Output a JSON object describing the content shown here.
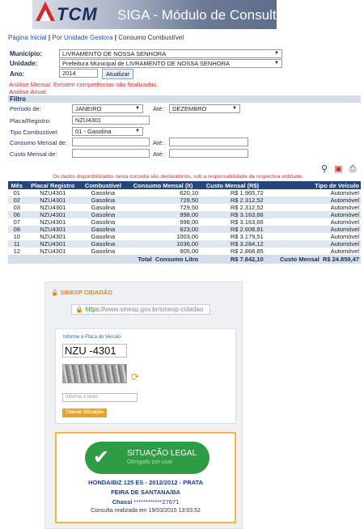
{
  "header": {
    "logo": "TCM",
    "title": "SIGA - Módulo de Consulta"
  },
  "breadcrumb": {
    "home": "Página Inicial",
    "sep1": "|",
    "gestora": "Por Unidade Gestora",
    "sep2": "|",
    "current": "Consumo Combustível"
  },
  "form": {
    "municipio_label": "Município:",
    "municipio_value": "LIVRAMENTO DE NOSSA SENHORA",
    "unidade_label": "Unidade:",
    "unidade_value": "Prefeitura Municipal de LIVRAMENTO DE NOSSA SENHORA",
    "ano_label": "Ano:",
    "ano_value": "2014",
    "atualizar": "Atualizar",
    "warn1": "Análise Mensal: Existem competências não finalizadas.",
    "warn2": "Análise Anual:"
  },
  "filtro": {
    "title": "Filtro",
    "periodo_label": "Período de:",
    "periodo_de": "JANEIRO",
    "ate_label": "Até:",
    "periodo_ate": "DEZEMBRO",
    "placa_label": "Placa/Registro:",
    "placa_value": "NZU4301",
    "tipo_label": "Tipo Combustível:",
    "tipo_value": "01 - Gasolina",
    "consumo_label": "Consumo Mensal de:",
    "consumo_ate_label": "Até:",
    "custo_label": "Custo Mensal de:",
    "custo_ate_label": "Até:"
  },
  "note": "Os dados disponibilizados nesta consulta são declaratórios, sob a responsabilidade da respectiva entidade.",
  "table": {
    "headers": [
      "Mês",
      "Placa/ Registro",
      "Combustível",
      "Consumo Mensal (lt)",
      "Custo Mensal (R$)",
      "Tipo de Veículo"
    ],
    "rows": [
      [
        "01",
        "NZU4301",
        "Gasolina",
        "620,10",
        "R$ 1.965,72",
        "Automóvel"
      ],
      [
        "02",
        "NZU4301",
        "Gasolina",
        "729,50",
        "R$ 2.312,52",
        "Automóvel"
      ],
      [
        "03",
        "NZU4301",
        "Gasolina",
        "729,50",
        "R$ 2.312,52",
        "Automóvel"
      ],
      [
        "06",
        "NZU4301",
        "Gasolina",
        "998,00",
        "R$ 3.163,66",
        "Automóvel"
      ],
      [
        "07",
        "NZU4301",
        "Gasolina",
        "998,00",
        "R$ 3.163,66",
        "Automóvel"
      ],
      [
        "08",
        "NZU4301",
        "Gasolina",
        "823,00",
        "R$ 2.608,91",
        "Automóvel"
      ],
      [
        "10",
        "NZU4301",
        "Gasolina",
        "1003,00",
        "R$ 3.179,51",
        "Automóvel"
      ],
      [
        "11",
        "NZU4301",
        "Gasolina",
        "1036,00",
        "R$ 3.284,12",
        "Automóvel"
      ],
      [
        "12",
        "NZU4301",
        "Gasolina",
        "905,00",
        "R$ 2.868,85",
        "Automóvel"
      ]
    ],
    "footer": {
      "total": "Total",
      "litro_label": "Consumo Litro",
      "litro_value": "R$ 7.842,10",
      "custo_label": "Custo Mensal",
      "custo_value": "R$ 24.859,47"
    }
  },
  "sinesp": {
    "title": "SINESP CIDADÃO",
    "url_https": "https://",
    "url_rest": "www.sinesp.gov.br/sinesp-cidadao",
    "hint": "Informe a Placa do Veículo",
    "plate_letters": "NZU",
    "plate_dash": "-",
    "plate_numbers": "4301",
    "input_placeholder": "Informe o texto",
    "check_button": "Checar Situação",
    "status": "SITUAÇÃO LEGAL",
    "status_sub": "Obrigado por usar",
    "vehicle": "HONDA/BIZ 125 ES - 2012/2012 - PRATA",
    "city": "FEIRA DE SANTANA/BA",
    "chassi_label": "Chassi",
    "chassi_value": "************27671",
    "consulta": "Consulta realizada em 19/03/2015 13:03:52"
  },
  "colors": {
    "header_navy": "#1a2d5e",
    "table_header": "#27447c",
    "alert": "#d33333",
    "legal_green": "#2e9b45",
    "orange": "#f0a11e"
  }
}
